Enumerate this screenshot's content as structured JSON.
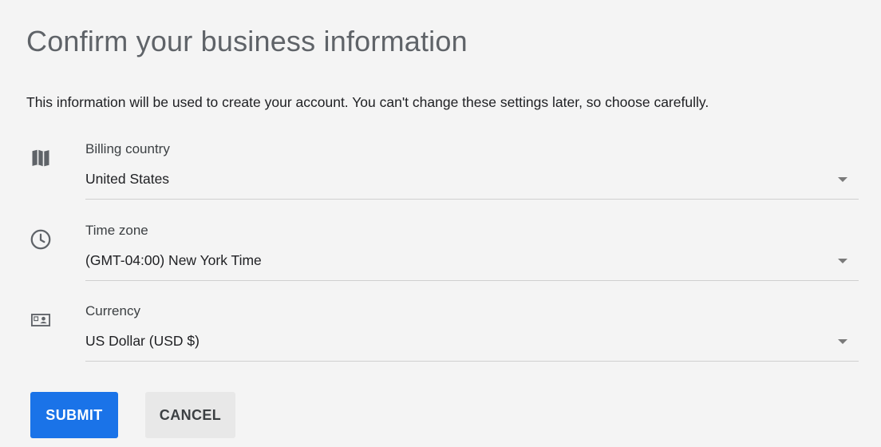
{
  "page": {
    "title": "Confirm your business information",
    "description": "This information will be used to create your account. You can't change these settings later, so choose carefully."
  },
  "fields": {
    "billing_country": {
      "icon": "map-icon",
      "label": "Billing country",
      "value": "United States"
    },
    "time_zone": {
      "icon": "clock-icon",
      "label": "Time zone",
      "value": "(GMT-04:00) New York Time"
    },
    "currency": {
      "icon": "currency-bill-icon",
      "label": "Currency",
      "value": "US Dollar (USD $)"
    }
  },
  "actions": {
    "submit_label": "SUBMIT",
    "cancel_label": "CANCEL"
  },
  "colors": {
    "background": "#f4f4f4",
    "primary": "#1a73e8",
    "secondary_button": "#e8e8e8",
    "title": "#5f6368",
    "icon": "#5f6368",
    "divider": "#d0d0d0"
  }
}
